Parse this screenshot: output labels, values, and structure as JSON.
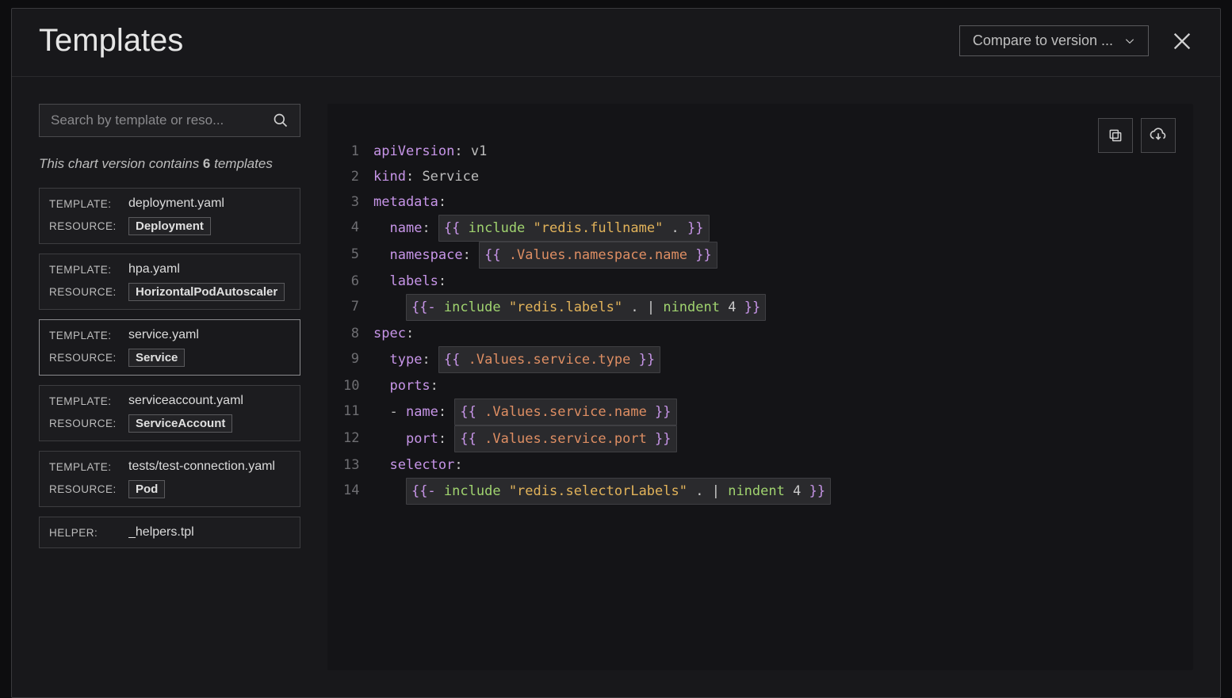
{
  "header": {
    "title": "Templates",
    "compare_label": "Compare to version ..."
  },
  "sidebar": {
    "search_placeholder": "Search by template or reso...",
    "summary_prefix": "This chart version contains ",
    "summary_count": "6",
    "summary_suffix": " templates",
    "labels": {
      "template": "TEMPLATE:",
      "resource": "RESOURCE:",
      "helper": "HELPER:"
    },
    "items": [
      {
        "type": "template",
        "template": "deployment.yaml",
        "resource": "Deployment",
        "selected": false
      },
      {
        "type": "template",
        "template": "hpa.yaml",
        "resource": "HorizontalPodAutoscaler",
        "selected": false
      },
      {
        "type": "template",
        "template": "service.yaml",
        "resource": "Service",
        "selected": true
      },
      {
        "type": "template",
        "template": "serviceaccount.yaml",
        "resource": "ServiceAccount",
        "selected": false
      },
      {
        "type": "template",
        "template": "tests/test-connection.yaml",
        "resource": "Pod",
        "selected": false
      },
      {
        "type": "helper",
        "template": "_helpers.tpl",
        "selected": false
      }
    ]
  },
  "code": {
    "lines": [
      {
        "n": 1,
        "tokens": [
          {
            "t": "apiVersion",
            "c": "key"
          },
          {
            "t": ": ",
            "c": "punct"
          },
          {
            "t": "v1",
            "c": "plain"
          }
        ]
      },
      {
        "n": 2,
        "tokens": [
          {
            "t": "kind",
            "c": "key"
          },
          {
            "t": ": ",
            "c": "punct"
          },
          {
            "t": "Service",
            "c": "plain"
          }
        ]
      },
      {
        "n": 3,
        "tokens": [
          {
            "t": "metadata",
            "c": "key"
          },
          {
            "t": ":",
            "c": "punct"
          }
        ]
      },
      {
        "n": 4,
        "tokens": [
          {
            "t": "  ",
            "c": "plain"
          },
          {
            "t": "name",
            "c": "key"
          },
          {
            "t": ": ",
            "c": "punct"
          },
          {
            "box": true,
            "tokens": [
              {
                "t": "{{ ",
                "c": "brace"
              },
              {
                "t": "include",
                "c": "include"
              },
              {
                "t": " ",
                "c": "plain"
              },
              {
                "t": "\"redis.fullname\"",
                "c": "string"
              },
              {
                "t": " . ",
                "c": "dot"
              },
              {
                "t": "}}",
                "c": "brace"
              }
            ]
          }
        ]
      },
      {
        "n": 5,
        "tokens": [
          {
            "t": "  ",
            "c": "plain"
          },
          {
            "t": "namespace",
            "c": "key"
          },
          {
            "t": ": ",
            "c": "punct"
          },
          {
            "box": true,
            "tokens": [
              {
                "t": "{{ ",
                "c": "brace"
              },
              {
                "t": ".Values.namespace.name",
                "c": "values"
              },
              {
                "t": " }}",
                "c": "brace"
              }
            ]
          }
        ]
      },
      {
        "n": 6,
        "tokens": [
          {
            "t": "  ",
            "c": "plain"
          },
          {
            "t": "labels",
            "c": "key"
          },
          {
            "t": ":",
            "c": "punct"
          }
        ]
      },
      {
        "n": 7,
        "tokens": [
          {
            "t": "    ",
            "c": "plain"
          },
          {
            "box": true,
            "tokens": [
              {
                "t": "{{- ",
                "c": "brace"
              },
              {
                "t": "include",
                "c": "include"
              },
              {
                "t": " ",
                "c": "plain"
              },
              {
                "t": "\"redis.labels\"",
                "c": "string"
              },
              {
                "t": " . ",
                "c": "dot"
              },
              {
                "t": "|",
                "c": "pipe"
              },
              {
                "t": " ",
                "c": "plain"
              },
              {
                "t": "nindent",
                "c": "fn"
              },
              {
                "t": " ",
                "c": "plain"
              },
              {
                "t": "4",
                "c": "num"
              },
              {
                "t": " }}",
                "c": "brace"
              }
            ]
          }
        ]
      },
      {
        "n": 8,
        "tokens": [
          {
            "t": "spec",
            "c": "key"
          },
          {
            "t": ":",
            "c": "punct"
          }
        ]
      },
      {
        "n": 9,
        "tokens": [
          {
            "t": "  ",
            "c": "plain"
          },
          {
            "t": "type",
            "c": "key"
          },
          {
            "t": ": ",
            "c": "punct"
          },
          {
            "box": true,
            "tokens": [
              {
                "t": "{{ ",
                "c": "brace"
              },
              {
                "t": ".Values.service.type",
                "c": "values"
              },
              {
                "t": " }}",
                "c": "brace"
              }
            ]
          }
        ]
      },
      {
        "n": 10,
        "tokens": [
          {
            "t": "  ",
            "c": "plain"
          },
          {
            "t": "ports",
            "c": "key"
          },
          {
            "t": ":",
            "c": "punct"
          }
        ]
      },
      {
        "n": 11,
        "tokens": [
          {
            "t": "  - ",
            "c": "plain"
          },
          {
            "t": "name",
            "c": "key"
          },
          {
            "t": ": ",
            "c": "punct"
          },
          {
            "box": true,
            "tokens": [
              {
                "t": "{{ ",
                "c": "brace"
              },
              {
                "t": ".Values.service.name",
                "c": "values"
              },
              {
                "t": " }}",
                "c": "brace"
              }
            ]
          }
        ]
      },
      {
        "n": 12,
        "tokens": [
          {
            "t": "    ",
            "c": "plain"
          },
          {
            "t": "port",
            "c": "key"
          },
          {
            "t": ": ",
            "c": "punct"
          },
          {
            "box": true,
            "tokens": [
              {
                "t": "{{ ",
                "c": "brace"
              },
              {
                "t": ".Values.service.port",
                "c": "values"
              },
              {
                "t": " }}",
                "c": "brace"
              }
            ]
          }
        ]
      },
      {
        "n": 13,
        "tokens": [
          {
            "t": "  ",
            "c": "plain"
          },
          {
            "t": "selector",
            "c": "key"
          },
          {
            "t": ":",
            "c": "punct"
          }
        ]
      },
      {
        "n": 14,
        "tokens": [
          {
            "t": "    ",
            "c": "plain"
          },
          {
            "box": true,
            "tokens": [
              {
                "t": "{{- ",
                "c": "brace"
              },
              {
                "t": "include",
                "c": "include"
              },
              {
                "t": " ",
                "c": "plain"
              },
              {
                "t": "\"redis.selectorLabels\"",
                "c": "string"
              },
              {
                "t": " . ",
                "c": "dot"
              },
              {
                "t": "|",
                "c": "pipe"
              },
              {
                "t": " ",
                "c": "plain"
              },
              {
                "t": "nindent",
                "c": "fn"
              },
              {
                "t": " ",
                "c": "plain"
              },
              {
                "t": "4",
                "c": "num"
              },
              {
                "t": " }}",
                "c": "brace"
              }
            ]
          }
        ]
      }
    ]
  }
}
